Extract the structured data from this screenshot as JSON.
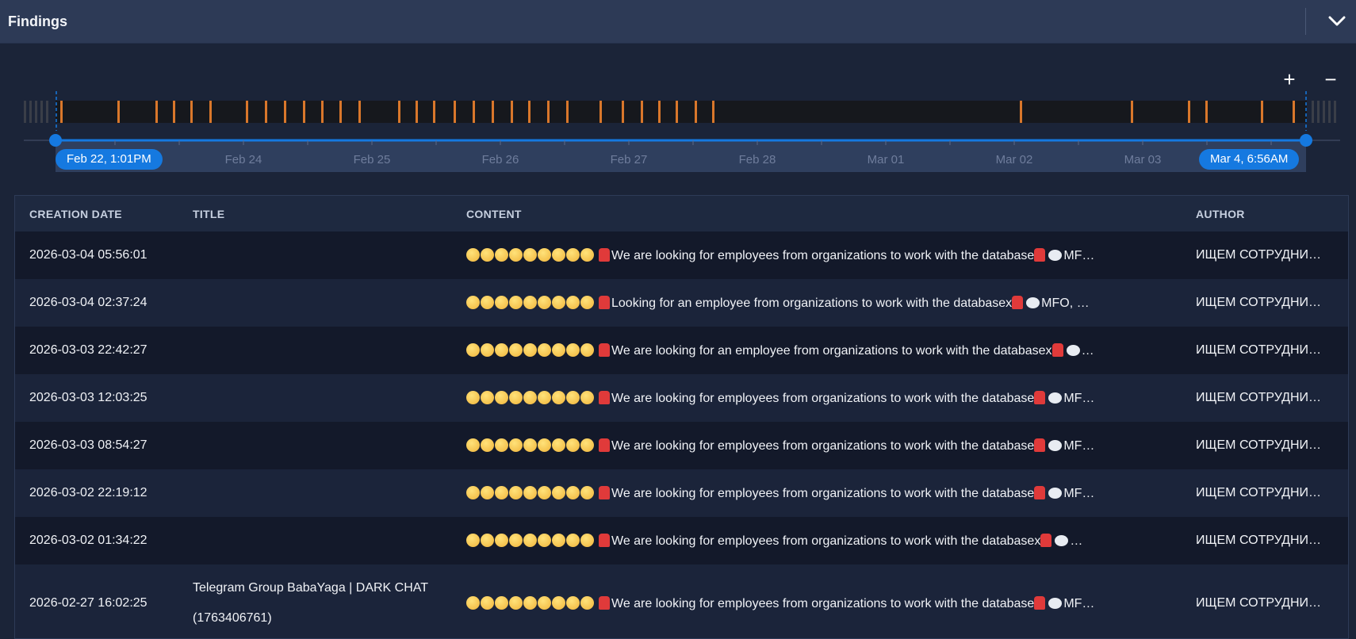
{
  "panel": {
    "title": "Findings"
  },
  "timeline": {
    "zoom_in": "+",
    "zoom_out": "−",
    "range_start_label": "Feb 22, 1:01PM",
    "range_end_label": "Mar 4, 6:56AM",
    "axis_labels": [
      "Feb 24",
      "Feb 25",
      "Feb 26",
      "Feb 27",
      "Feb 28",
      "Mar 01",
      "Mar 02",
      "Mar 03"
    ],
    "accent_color": "#1579e0",
    "event_color": "#d9772b"
  },
  "table": {
    "columns": [
      "CREATION DATE",
      "TITLE",
      "CONTENT",
      "AUTHOR"
    ],
    "rows": [
      {
        "date": "2026-03-04 05:56:01",
        "title": "",
        "content": "We are looking for employees from organizations to work with the database",
        "content_tail": "MF…",
        "author": "ИЩЕМ СОТРУДНИ…"
      },
      {
        "date": "2026-03-04 02:37:24",
        "title": "",
        "content": "Looking for an employee from organizations to work with the databasex",
        "content_tail": "MFO, …",
        "author": "ИЩЕМ СОТРУДНИ…"
      },
      {
        "date": "2026-03-03 22:42:27",
        "title": "",
        "content": "We are looking for an employee from organizations to work with the databasex",
        "content_tail": "…",
        "author": "ИЩЕМ СОТРУДНИ…"
      },
      {
        "date": "2026-03-03 12:03:25",
        "title": "",
        "content": "We are looking for employees from organizations to work with the database",
        "content_tail": "MF…",
        "author": "ИЩЕМ СОТРУДНИ…"
      },
      {
        "date": "2026-03-03 08:54:27",
        "title": "",
        "content": "We are looking for employees from organizations to work with the database",
        "content_tail": "MF…",
        "author": "ИЩЕМ СОТРУДНИ…"
      },
      {
        "date": "2026-03-02 22:19:12",
        "title": "",
        "content": "We are looking for employees from organizations to work with the database",
        "content_tail": "MF…",
        "author": "ИЩЕМ СОТРУДНИ…"
      },
      {
        "date": "2026-03-02 01:34:22",
        "title": "",
        "content": "We are looking for employees from organizations to work with the databasex",
        "content_tail": "…",
        "author": "ИЩЕМ СОТРУДНИ…"
      },
      {
        "date": "2026-02-27 16:02:25",
        "title": "Telegram Group BabaYaga | DARK CHAT (1763406761)",
        "content": "We are looking for employees from organizations to work with the database",
        "content_tail": "MF…",
        "author": "ИЩЕМ СОТРУДНИ…"
      }
    ]
  }
}
